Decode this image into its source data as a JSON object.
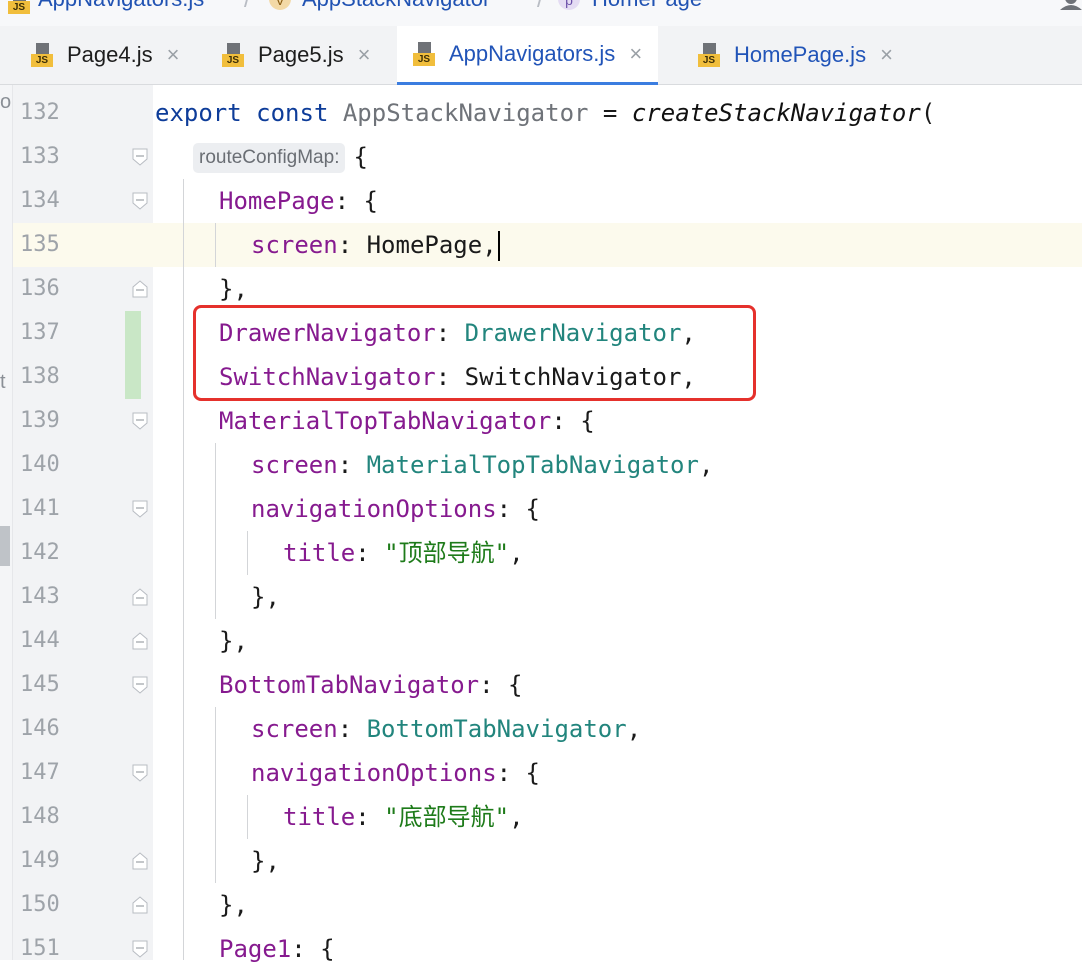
{
  "breadcrumb": {
    "items": [
      {
        "label": "AppNavigators.js",
        "icon": "js-file-icon"
      },
      {
        "label": "AppStackNavigator",
        "icon": "variable-icon",
        "icon_letter": "V"
      },
      {
        "label": "HomePage",
        "icon": "property-icon",
        "icon_letter": "p"
      }
    ]
  },
  "tabs": [
    {
      "label": "Page4.js",
      "active": false
    },
    {
      "label": "Page5.js",
      "active": false
    },
    {
      "label": "AppNavigators.js",
      "active": true
    },
    {
      "label": "HomePage.js",
      "active": false
    }
  ],
  "js_badge": "JS",
  "close_glyph": "×",
  "left_strip": {
    "glyph_top": "o",
    "glyph_mid": "t"
  },
  "editor": {
    "line_numbers": [
      "132",
      "133",
      "134",
      "135",
      "136",
      "137",
      "138",
      "139",
      "140",
      "141",
      "142",
      "143",
      "144",
      "145",
      "146",
      "147",
      "148",
      "149",
      "150",
      "151"
    ],
    "inlay_hint": "routeConfigMap:",
    "tokens": {
      "l132_kw": "export const ",
      "l132_name": "AppStackNavigator",
      "l132_eq": " = ",
      "l132_fn": "createStackNavigator",
      "l132_paren": "(",
      "l133_brace": "{",
      "l134_key": "HomePage",
      "l134_rest": ": {",
      "l135_key": "screen",
      "l135_rest": ": HomePage,",
      "l136": "},",
      "l137_key": "DrawerNavigator",
      "l137_colon": ": ",
      "l137_val": "DrawerNavigator",
      "l137_comma": ",",
      "l138_key": "SwitchNavigator",
      "l138_rest": ": SwitchNavigator,",
      "l139_key": "MaterialTopTabNavigator",
      "l139_rest": ": {",
      "l140_key": "screen",
      "l140_colon": ": ",
      "l140_val": "MaterialTopTabNavigator",
      "l140_comma": ",",
      "l141_key": "navigationOptions",
      "l141_rest": ": {",
      "l142_key": "title",
      "l142_colon": ": ",
      "l142_str": "\"顶部导航\"",
      "l142_comma": ",",
      "l143": "},",
      "l144": "},",
      "l145_key": "BottomTabNavigator",
      "l145_rest": ": {",
      "l146_key": "screen",
      "l146_colon": ": ",
      "l146_val": "BottomTabNavigator",
      "l146_comma": ",",
      "l147_key": "navigationOptions",
      "l147_rest": ": {",
      "l148_key": "title",
      "l148_colon": ": ",
      "l148_str": "\"底部导航\"",
      "l148_comma": ",",
      "l149": "},",
      "l150": "},",
      "l151_key": "Page1",
      "l151_rest": ": {"
    }
  },
  "colors": {
    "keyword": "#0d3c99",
    "property": "#861a8f",
    "reference": "#22857d",
    "string": "#1e7b1a",
    "highlight_box": "#e5312c",
    "active_tab": "#2154b8"
  }
}
